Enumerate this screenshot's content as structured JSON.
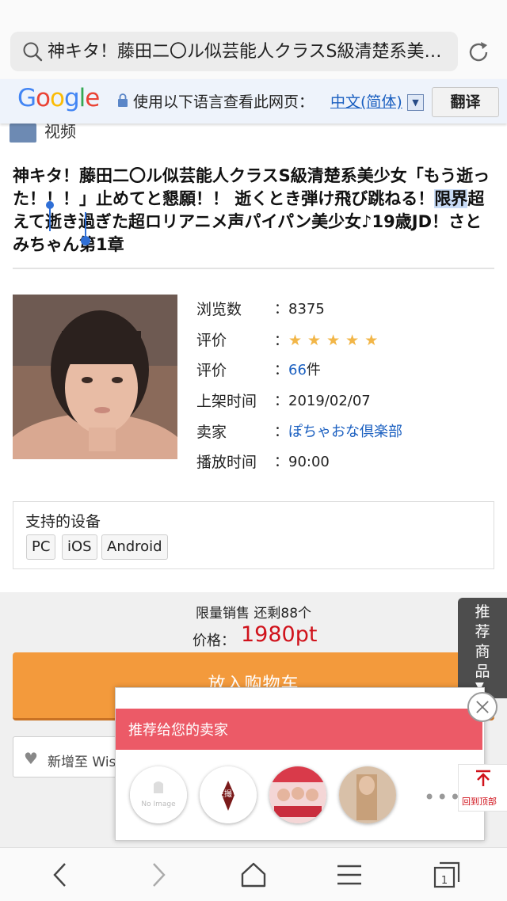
{
  "browser": {
    "url_text": "神キタ！藤田二〇ル似芸能人クラスS級清楚系美少女「もう逝った！！！」",
    "tab_count": "1"
  },
  "translate_bar": {
    "logo": "Google",
    "message": "使用以下语言查看此网页：",
    "language": "中文(简体)",
    "translate_button": "翻译"
  },
  "section_label": "视频",
  "product": {
    "title_before": "神キタ！藤田二〇ル似芸能人クラスS級清楚系美少女「もう逝った！！！」止めてと懇願！！ 逝くとき弾け飛び跳ねる！",
    "title_selected": "限界",
    "title_after": "超えて逝き過ぎた超ロリアニメ声パイパン美少女♪19歳JD！さとみちゃん第1章",
    "info": [
      {
        "label": "浏览数",
        "value": "8375"
      },
      {
        "label": "评价",
        "value": "★★★★★",
        "stars": 5
      },
      {
        "label": "评价",
        "value_link": "66",
        "value_suffix": "件"
      },
      {
        "label": "上架时间",
        "value": "2019/02/07"
      },
      {
        "label": "卖家",
        "value_link": "ぽちゃおな倶楽部"
      },
      {
        "label": "播放时间",
        "value": "90:00"
      }
    ],
    "colon": "："
  },
  "devices": {
    "title": "支持的设备",
    "items": [
      "PC",
      "iOS",
      "Android"
    ]
  },
  "purchase": {
    "limited_text": "限量销售 还剩88个",
    "price_label": "价格：",
    "price_value": "1980pt",
    "cart_button": "放入购物车",
    "wishlist_button": "新增至 Wishlist"
  },
  "recommend_tab": {
    "label": "推荐商品",
    "arrow": "▼"
  },
  "seller_popup": {
    "title": "推荐给您的卖家",
    "no_image_text": "No Image",
    "seller2_caption": "生撮り",
    "more": "•••"
  },
  "back_to_top": {
    "label": "回到顶部"
  },
  "colors": {
    "accent_orange": "#f39a3c",
    "price_red": "#d0121b",
    "popup_header": "#ec5a67",
    "link_blue": "#1a5fc0",
    "star_yellow": "#f2b648"
  }
}
